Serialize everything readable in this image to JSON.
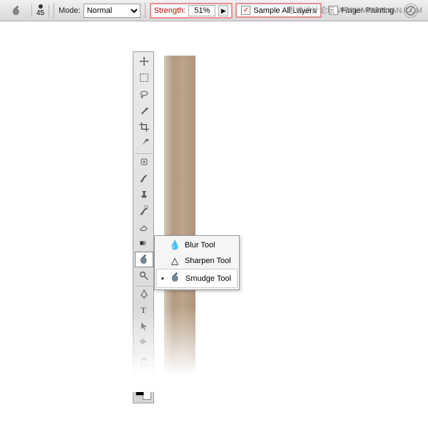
{
  "watermark": "思缘设计论坛  WWW.MISSYUAN.COM",
  "options_bar": {
    "brush_size": "45",
    "mode_label": "Mode:",
    "mode_value": "Normal",
    "strength_label": "Strength:",
    "strength_value": "51%",
    "arrow": "▶",
    "sample_all_layers": "Sample All Layers",
    "sample_all_layers_checked": "✓",
    "finger_painting": "Finger Painting"
  },
  "flyout": {
    "items": [
      {
        "label": "Blur Tool",
        "icon": "💧",
        "active": false
      },
      {
        "label": "Sharpen Tool",
        "icon": "△",
        "active": false
      },
      {
        "label": "Smudge Tool",
        "icon": "👆",
        "active": true
      }
    ],
    "active_indicator": "▪"
  }
}
